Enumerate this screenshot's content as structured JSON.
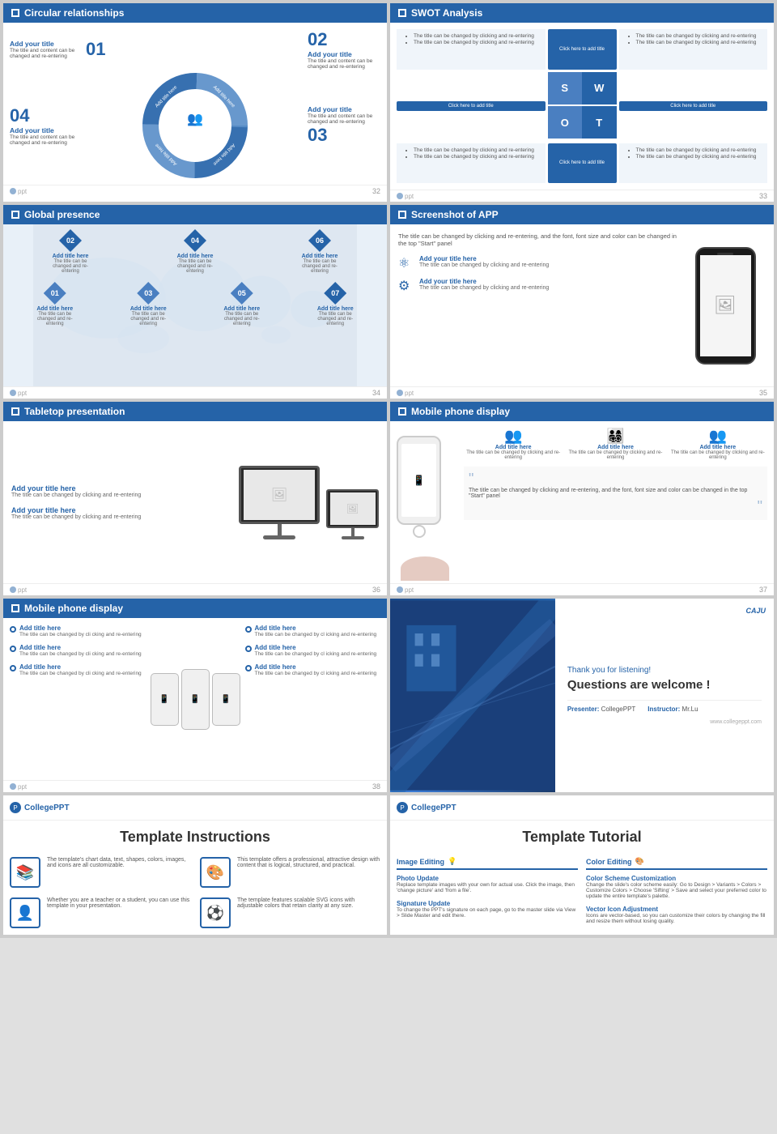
{
  "slides": [
    {
      "id": "slide1",
      "header": "Circular relationships",
      "type": "circular",
      "items": [
        {
          "num": "01",
          "title": "Add your title",
          "desc": "The title and content can be changed and re-entering"
        },
        {
          "num": "02",
          "title": "Add your title",
          "desc": "The title and content can be changed and re-entering"
        },
        {
          "num": "03",
          "title": "Add your title",
          "desc": "The title and content can be changed and re-entering"
        },
        {
          "num": "04",
          "title": "Add your title",
          "desc": "The title and content can be changed and re-entering"
        }
      ],
      "pageNum": "32"
    },
    {
      "id": "slide2",
      "header": "SWOT Analysis",
      "type": "swot",
      "items": [
        {
          "label": "The title can be changed by clicking and re-entering",
          "repeat": 3
        },
        {
          "label": "The title can be changed by clicking and re-entering",
          "repeat": 3
        }
      ],
      "buttons": [
        "Click here to add title",
        "Click here to add title",
        "Click here to add title",
        "Click here to add title"
      ],
      "pageNum": "33"
    },
    {
      "id": "slide3",
      "header": "Global presence",
      "type": "global",
      "nodes": [
        {
          "num": "01",
          "title": "Add title here",
          "desc": "The title can be changed and re-entering"
        },
        {
          "num": "02",
          "title": "Add title here",
          "desc": "The title can be changed and re-entering"
        },
        {
          "num": "03",
          "title": "Add title here",
          "desc": "The title can be changed and re-entering"
        },
        {
          "num": "04",
          "title": "Add title here",
          "desc": "The title can be changed and re-entering"
        },
        {
          "num": "05",
          "title": "Add title here",
          "desc": "The title can be changed and re-entering"
        },
        {
          "num": "06",
          "title": "Add title here",
          "desc": "The title can be changed and re-entering"
        },
        {
          "num": "07",
          "title": "Add title here",
          "desc": "The title can be changed and re-entering"
        }
      ],
      "pageNum": "34"
    },
    {
      "id": "slide4",
      "header": "Screenshot of APP",
      "type": "app",
      "mainText": "The title can be changed by clicking and re-entering, and the font, font size and color can be changed in the top \"Start\" panel",
      "features": [
        {
          "title": "Add your title here",
          "desc": "The title can be changed by clicking and re-entering"
        },
        {
          "title": "Add your title here",
          "desc": "The title can be changed by clicking and re-entering"
        }
      ],
      "pageNum": "35"
    },
    {
      "id": "slide5",
      "header": "Tabletop presentation",
      "type": "tabletop",
      "items": [
        {
          "title": "Add your title here",
          "desc": "The title can be changed by clicking and re-entering"
        },
        {
          "title": "Add your title here",
          "desc": "The title can be changed by clicking and re-entering"
        }
      ],
      "pageNum": "36"
    },
    {
      "id": "slide6",
      "header": "Mobile phone display",
      "type": "mobile",
      "features": [
        {
          "title": "Add title here",
          "desc": "The title can be changed by clicking and re-entering"
        },
        {
          "title": "Add title here",
          "desc": "The title can be changed by clicking and re-entering"
        },
        {
          "title": "Add title here",
          "desc": "The title can be changed by clicking and re-entering"
        }
      ],
      "quoteText": "The title can be changed by clicking and re-entering, and the font, font size and color can be changed in the top \"Start\" panel",
      "pageNum": "37"
    },
    {
      "id": "slide7",
      "header": "Mobile phone display",
      "type": "mobile2",
      "leftItems": [
        {
          "title": "Add title here",
          "desc": "The title can be changed by cli cking and re-entering"
        },
        {
          "title": "Add title here",
          "desc": "The title can be changed by cli cking and re-entering"
        },
        {
          "title": "Add title here",
          "desc": "The title can be changed by cli cking and re-entering"
        }
      ],
      "rightItems": [
        {
          "title": "Add title here",
          "desc": "The title can be changed by cl icking and re-entering"
        },
        {
          "title": "Add title here",
          "desc": "The title can be changed by cl icking and re-entering"
        },
        {
          "title": "Add title here",
          "desc": "The title can be changed by cl icking and re-entering"
        }
      ],
      "pageNum": "38"
    },
    {
      "id": "slide8",
      "type": "thankyou",
      "thankTitle": "Thank you for listening!",
      "thankSubtitle": "Questions are welcome !",
      "presenter": "CollegePPT",
      "instructor": "Mr.Lu",
      "website": "www.collegeppt.com",
      "logoText": "CAJU"
    },
    {
      "id": "slide9",
      "type": "instructions",
      "logoText": "CollegePPT",
      "title": "Template Instructions",
      "items": [
        {
          "icon": "📚",
          "desc": "The template's chart data, text, shapes, colors, images, and icons are all customizable."
        },
        {
          "icon": "🎨",
          "desc": "This template offers a professional, attractive design with content that is logical, structured, and practical."
        },
        {
          "icon": "👤",
          "desc": "Whether you are a teacher or a student, you can use this template in your presentation."
        },
        {
          "icon": "⚽",
          "desc": "The template features scalable SVG icons with adjustable colors that retain clarity at any size."
        }
      ]
    },
    {
      "id": "slide10",
      "type": "tutorial",
      "logoText": "CollegePPT",
      "title": "Template Tutorial",
      "sections": [
        {
          "title": "Image Editing",
          "icon": "💡",
          "subsections": [
            {
              "title": "Photo Update",
              "desc": "Replace template images with your own for actual use. Click the image, then 'change picture' and 'from a file'."
            },
            {
              "title": "Signature Update",
              "desc": "To change the PPT's signature on each page, go to the master slide via View > Slide Master and edit there."
            }
          ]
        },
        {
          "title": "Color Editing",
          "icon": "🎨",
          "subsections": [
            {
              "title": "Color Scheme Customization",
              "desc": "Change the slide's color scheme easily: Go to Design > Variants > Colors > Customize Colors > Choose 'Sifting' > Save and select your preferred color to update the entire template's palette."
            },
            {
              "title": "Vector Icon Adjustment",
              "desc": "Icons are vector-based, so you can customize their colors by changing the fill and resize them without losing quality."
            }
          ]
        }
      ]
    }
  ]
}
